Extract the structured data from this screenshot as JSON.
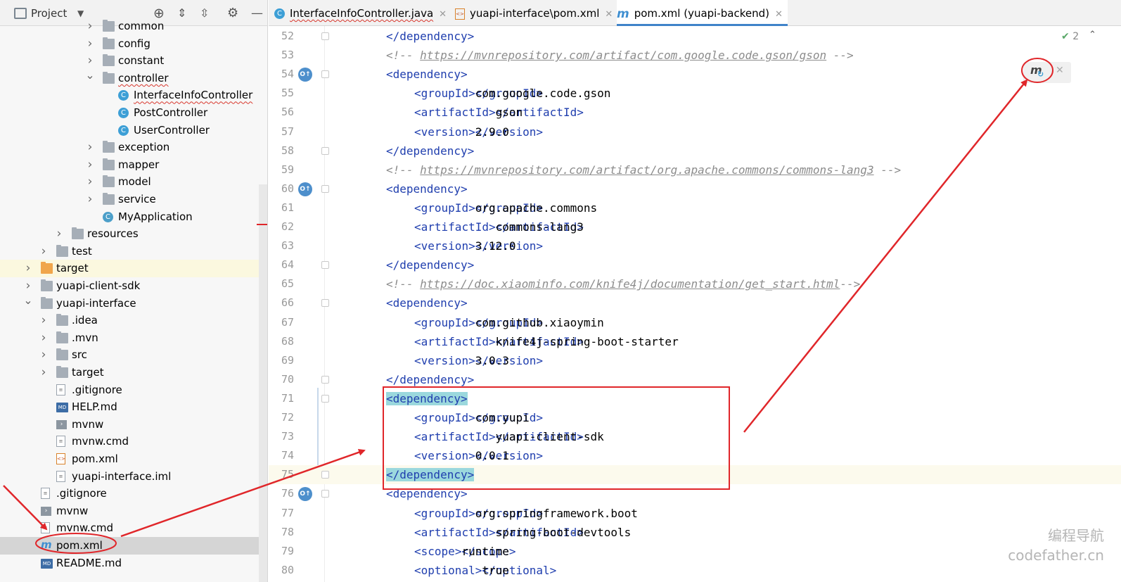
{
  "project_panel": {
    "title": "Project",
    "tree": [
      {
        "label": "common",
        "indent": 3,
        "icon": "folder-icon",
        "chevron": "right",
        "cut": true
      },
      {
        "label": "config",
        "indent": 3,
        "icon": "folder-icon",
        "chevron": "right"
      },
      {
        "label": "constant",
        "indent": 3,
        "icon": "folder-icon",
        "chevron": "right"
      },
      {
        "label": "controller",
        "indent": 3,
        "icon": "folder-icon",
        "chevron": "down",
        "underline": true
      },
      {
        "label": "InterfaceInfoController",
        "indent": 4,
        "icon": "class-icon",
        "underline": true
      },
      {
        "label": "PostController",
        "indent": 4,
        "icon": "class-icon"
      },
      {
        "label": "UserController",
        "indent": 4,
        "icon": "class-icon"
      },
      {
        "label": "exception",
        "indent": 3,
        "icon": "folder-icon",
        "chevron": "right"
      },
      {
        "label": "mapper",
        "indent": 3,
        "icon": "folder-icon",
        "chevron": "right"
      },
      {
        "label": "model",
        "indent": 3,
        "icon": "folder-icon",
        "chevron": "right"
      },
      {
        "label": "service",
        "indent": 3,
        "icon": "folder-icon",
        "chevron": "right"
      },
      {
        "label": "MyApplication",
        "indent": 3,
        "icon": "spring-app-icon"
      },
      {
        "label": "resources",
        "indent": 2,
        "icon": "resources-folder-icon",
        "chevron": "right"
      },
      {
        "label": "test",
        "indent": 1,
        "icon": "folder-icon",
        "chevron": "right"
      },
      {
        "label": "target",
        "indent": 0,
        "icon": "excluded-folder-icon",
        "chevron": "right",
        "highlight": "yellow"
      },
      {
        "label": "yuapi-client-sdk",
        "indent": 0,
        "icon": "module-folder-icon",
        "chevron": "right"
      },
      {
        "label": "yuapi-interface",
        "indent": 0,
        "icon": "module-folder-icon",
        "chevron": "down"
      },
      {
        "label": ".idea",
        "indent": 1,
        "icon": "folder-icon",
        "chevron": "right"
      },
      {
        "label": ".mvn",
        "indent": 1,
        "icon": "folder-icon",
        "chevron": "right"
      },
      {
        "label": "src",
        "indent": 1,
        "icon": "folder-icon",
        "chevron": "right"
      },
      {
        "label": "target",
        "indent": 1,
        "icon": "folder-icon",
        "chevron": "right"
      },
      {
        "label": ".gitignore",
        "indent": 1,
        "icon": "gitignore-file-icon"
      },
      {
        "label": "HELP.md",
        "indent": 1,
        "icon": "markdown-file-icon"
      },
      {
        "label": "mvnw",
        "indent": 1,
        "icon": "script-file-icon"
      },
      {
        "label": "mvnw.cmd",
        "indent": 1,
        "icon": "text-file-icon"
      },
      {
        "label": "pom.xml",
        "indent": 1,
        "icon": "xml-file-icon"
      },
      {
        "label": "yuapi-interface.iml",
        "indent": 1,
        "icon": "iml-file-icon"
      },
      {
        "label": ".gitignore",
        "indent": 0,
        "icon": "gitignore-file-icon"
      },
      {
        "label": "mvnw",
        "indent": 0,
        "icon": "script-file-icon"
      },
      {
        "label": "mvnw.cmd",
        "indent": 0,
        "icon": "text-file-icon"
      },
      {
        "label": "pom.xml",
        "indent": 0,
        "icon": "maven-icon",
        "highlight": "grey"
      },
      {
        "label": "README.md",
        "indent": 0,
        "icon": "markdown-file-icon"
      }
    ]
  },
  "tabs": [
    {
      "label": "InterfaceInfoController.java",
      "icon": "class-icon",
      "active": false,
      "underline": true
    },
    {
      "label": "yuapi-interface\\pom.xml",
      "icon": "xml-file-icon",
      "active": false
    },
    {
      "label": "pom.xml (yuapi-backend)",
      "icon": "maven-icon",
      "active": true
    }
  ],
  "editor": {
    "inspection_count": "2",
    "lines": [
      {
        "n": "52",
        "indent": 1,
        "parts": [
          [
            "tag",
            "</"
          ],
          [
            "tag",
            "dependency"
          ],
          [
            "tag",
            ">"
          ]
        ],
        "fold": true
      },
      {
        "n": "53",
        "indent": 1,
        "parts": [
          [
            "cmt",
            "<!-- "
          ],
          [
            "url",
            "https://mvnrepository.com/artifact/com.google.code.gson/gson"
          ],
          [
            "cmt",
            " -->"
          ]
        ]
      },
      {
        "n": "54",
        "indent": 1,
        "parts": [
          [
            "tag",
            "<"
          ],
          [
            "tag",
            "dependency"
          ],
          [
            "tag",
            ">"
          ]
        ],
        "fold": true,
        "gutter": true
      },
      {
        "n": "55",
        "indent": 2,
        "parts": [
          [
            "tag",
            "<"
          ],
          [
            "tag",
            "groupId"
          ],
          [
            "tag",
            ">"
          ],
          [
            "txt",
            "com.google.code.gson"
          ],
          [
            "tag",
            "</"
          ],
          [
            "tag",
            "groupId"
          ],
          [
            "tag",
            ">"
          ]
        ]
      },
      {
        "n": "56",
        "indent": 2,
        "parts": [
          [
            "tag",
            "<"
          ],
          [
            "tag",
            "artifactId"
          ],
          [
            "tag",
            ">"
          ],
          [
            "txt",
            "gson"
          ],
          [
            "tag",
            "</"
          ],
          [
            "tag",
            "artifactId"
          ],
          [
            "tag",
            ">"
          ]
        ]
      },
      {
        "n": "57",
        "indent": 2,
        "parts": [
          [
            "tag",
            "<"
          ],
          [
            "tag",
            "version"
          ],
          [
            "tag",
            ">"
          ],
          [
            "txt",
            "2.9.0"
          ],
          [
            "tag",
            "</"
          ],
          [
            "tag",
            "version"
          ],
          [
            "tag",
            ">"
          ]
        ]
      },
      {
        "n": "58",
        "indent": 1,
        "parts": [
          [
            "tag",
            "</"
          ],
          [
            "tag",
            "dependency"
          ],
          [
            "tag",
            ">"
          ]
        ],
        "fold": true
      },
      {
        "n": "59",
        "indent": 1,
        "parts": [
          [
            "cmt",
            "<!-- "
          ],
          [
            "url",
            "https://mvnrepository.com/artifact/org.apache.commons/commons-lang3"
          ],
          [
            "cmt",
            " -->"
          ]
        ]
      },
      {
        "n": "60",
        "indent": 1,
        "parts": [
          [
            "tag",
            "<"
          ],
          [
            "tag",
            "dependency"
          ],
          [
            "tag",
            ">"
          ]
        ],
        "fold": true,
        "gutter": true
      },
      {
        "n": "61",
        "indent": 2,
        "parts": [
          [
            "tag",
            "<"
          ],
          [
            "tag",
            "groupId"
          ],
          [
            "tag",
            ">"
          ],
          [
            "txt",
            "org.apache.commons"
          ],
          [
            "tag",
            "</"
          ],
          [
            "tag",
            "groupId"
          ],
          [
            "tag",
            ">"
          ]
        ]
      },
      {
        "n": "62",
        "indent": 2,
        "parts": [
          [
            "tag",
            "<"
          ],
          [
            "tag",
            "artifactId"
          ],
          [
            "tag",
            ">"
          ],
          [
            "txt",
            "commons-lang3"
          ],
          [
            "tag",
            "</"
          ],
          [
            "tag",
            "artifactId"
          ],
          [
            "tag",
            ">"
          ]
        ]
      },
      {
        "n": "63",
        "indent": 2,
        "parts": [
          [
            "tag",
            "<"
          ],
          [
            "tag",
            "version"
          ],
          [
            "tag",
            ">"
          ],
          [
            "txt",
            "3.12.0"
          ],
          [
            "tag",
            "</"
          ],
          [
            "tag",
            "version"
          ],
          [
            "tag",
            ">"
          ]
        ]
      },
      {
        "n": "64",
        "indent": 1,
        "parts": [
          [
            "tag",
            "</"
          ],
          [
            "tag",
            "dependency"
          ],
          [
            "tag",
            ">"
          ]
        ],
        "fold": true
      },
      {
        "n": "65",
        "indent": 1,
        "parts": [
          [
            "cmt",
            "<!-- "
          ],
          [
            "url",
            "https://doc.xiaominfo.com/knife4j/documentation/get_start.html"
          ],
          [
            "cmt",
            "-->"
          ]
        ]
      },
      {
        "n": "66",
        "indent": 1,
        "parts": [
          [
            "tag",
            "<"
          ],
          [
            "tag",
            "dependency"
          ],
          [
            "tag",
            ">"
          ]
        ],
        "fold": true
      },
      {
        "n": "67",
        "indent": 2,
        "parts": [
          [
            "tag",
            "<"
          ],
          [
            "tag",
            "groupId"
          ],
          [
            "tag",
            ">"
          ],
          [
            "txt",
            "com.github.xiaoymin"
          ],
          [
            "tag",
            "</"
          ],
          [
            "tag",
            "groupId"
          ],
          [
            "tag",
            ">"
          ]
        ]
      },
      {
        "n": "68",
        "indent": 2,
        "parts": [
          [
            "tag",
            "<"
          ],
          [
            "tag",
            "artifactId"
          ],
          [
            "tag",
            ">"
          ],
          [
            "txt",
            "knife4j-spring-boot-starter"
          ],
          [
            "tag",
            "</"
          ],
          [
            "tag",
            "artifactId"
          ],
          [
            "tag",
            ">"
          ]
        ]
      },
      {
        "n": "69",
        "indent": 2,
        "parts": [
          [
            "tag",
            "<"
          ],
          [
            "tag",
            "version"
          ],
          [
            "tag",
            ">"
          ],
          [
            "txt",
            "3.0.3"
          ],
          [
            "tag",
            "</"
          ],
          [
            "tag",
            "version"
          ],
          [
            "tag",
            ">"
          ]
        ]
      },
      {
        "n": "70",
        "indent": 1,
        "parts": [
          [
            "tag",
            "</"
          ],
          [
            "tag",
            "dependency"
          ],
          [
            "tag",
            ">"
          ]
        ],
        "fold": true
      },
      {
        "n": "71",
        "indent": 1,
        "parts": [
          [
            "match",
            "<dependency>"
          ]
        ],
        "fold": true
      },
      {
        "n": "72",
        "indent": 2,
        "parts": [
          [
            "tag",
            "<"
          ],
          [
            "tag",
            "groupId"
          ],
          [
            "tag",
            ">"
          ],
          [
            "txt",
            "com.yupi"
          ],
          [
            "tag",
            "</"
          ],
          [
            "tag",
            "groupId"
          ],
          [
            "tag",
            ">"
          ]
        ]
      },
      {
        "n": "73",
        "indent": 2,
        "parts": [
          [
            "tag",
            "<"
          ],
          [
            "tag",
            "artifactId"
          ],
          [
            "tag",
            ">"
          ],
          [
            "txt",
            "yuapi-client-sdk"
          ],
          [
            "tag",
            "</"
          ],
          [
            "tag",
            "artifactId"
          ],
          [
            "tag",
            ">"
          ]
        ]
      },
      {
        "n": "74",
        "indent": 2,
        "parts": [
          [
            "tag",
            "<"
          ],
          [
            "tag",
            "version"
          ],
          [
            "tag",
            ">"
          ],
          [
            "txt",
            "0.0.1"
          ],
          [
            "tag",
            "</"
          ],
          [
            "tag",
            "version"
          ],
          [
            "tag",
            ">"
          ]
        ]
      },
      {
        "n": "75",
        "indent": 1,
        "parts": [
          [
            "match",
            "</dependency>"
          ]
        ],
        "fold": true,
        "current": true
      },
      {
        "n": "76",
        "indent": 1,
        "parts": [
          [
            "tag",
            "<"
          ],
          [
            "tag",
            "dependency"
          ],
          [
            "tag",
            ">"
          ]
        ],
        "fold": true,
        "gutter": true
      },
      {
        "n": "77",
        "indent": 2,
        "parts": [
          [
            "tag",
            "<"
          ],
          [
            "tag",
            "groupId"
          ],
          [
            "tag",
            ">"
          ],
          [
            "txt",
            "org.springframework.boot"
          ],
          [
            "tag",
            "</"
          ],
          [
            "tag",
            "groupId"
          ],
          [
            "tag",
            ">"
          ]
        ]
      },
      {
        "n": "78",
        "indent": 2,
        "parts": [
          [
            "tag",
            "<"
          ],
          [
            "tag",
            "artifactId"
          ],
          [
            "tag",
            ">"
          ],
          [
            "txt",
            "spring-boot-devtools"
          ],
          [
            "tag",
            "</"
          ],
          [
            "tag",
            "artifactId"
          ],
          [
            "tag",
            ">"
          ]
        ]
      },
      {
        "n": "79",
        "indent": 2,
        "parts": [
          [
            "tag",
            "<"
          ],
          [
            "tag",
            "scope"
          ],
          [
            "tag",
            ">"
          ],
          [
            "txt",
            "runtime"
          ],
          [
            "tag",
            "</"
          ],
          [
            "tag",
            "scope"
          ],
          [
            "tag",
            ">"
          ]
        ]
      },
      {
        "n": "80",
        "indent": 2,
        "parts": [
          [
            "tag",
            "<"
          ],
          [
            "tag",
            "optional"
          ],
          [
            "tag",
            ">"
          ],
          [
            "txt",
            "true"
          ],
          [
            "tag",
            "</"
          ],
          [
            "tag",
            "optional"
          ],
          [
            "tag",
            ">"
          ]
        ]
      }
    ]
  },
  "watermark": {
    "line1": "编程导航",
    "line2": "codefather.cn"
  },
  "colors": {
    "annotation_red": "#e0262a",
    "tag_blue": "#1f3eae",
    "comment_grey": "#8c8c8c",
    "tab_active_underline": "#4083c9"
  }
}
